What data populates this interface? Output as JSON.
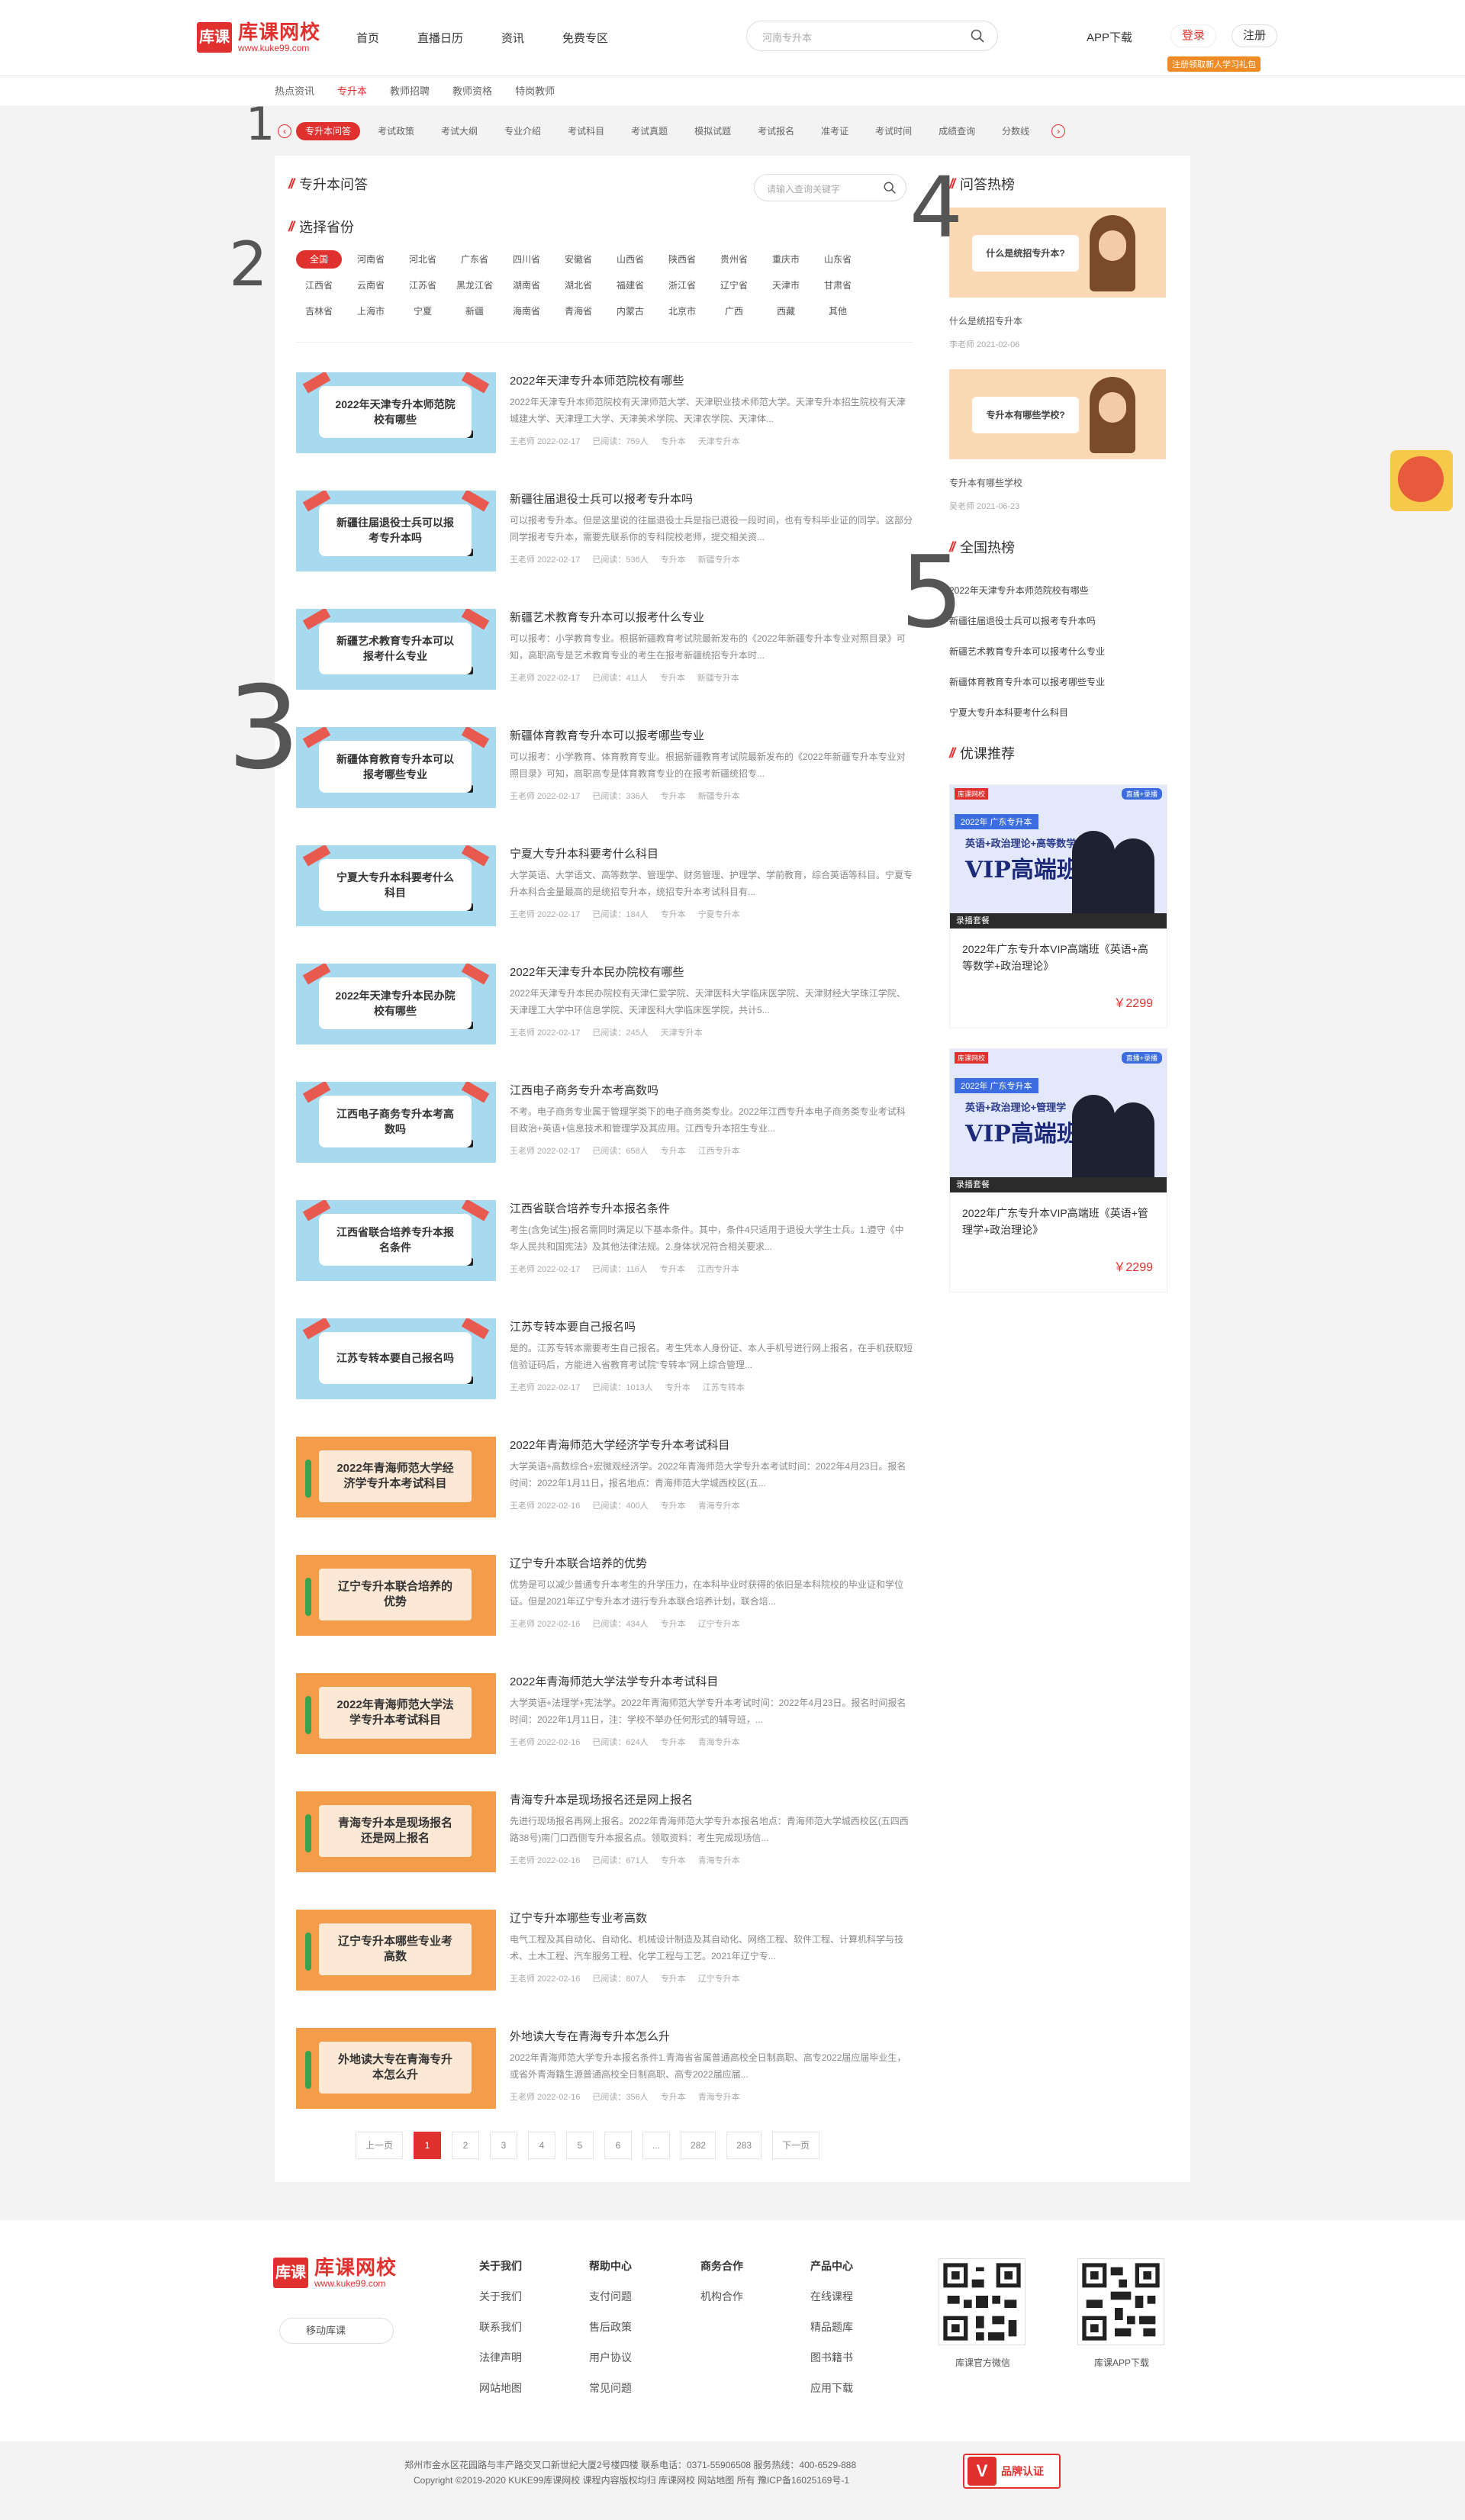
{
  "header": {
    "logo_char": "库课",
    "logo_name": "库课网校",
    "logo_url": "www.kuke99.com",
    "nav": [
      "首页",
      "直播日历",
      "资讯",
      "免费专区"
    ],
    "search_placeholder": "河南专升本",
    "app_download": "APP下载",
    "login": "登录",
    "register": "注册",
    "register_badge": "注册领取新人学习礼包"
  },
  "subnav": {
    "items": [
      "热点资讯",
      "专升本",
      "教师招聘",
      "教师资格",
      "特岗教师"
    ],
    "active": 1
  },
  "tagbar": {
    "tags": [
      "专升本问答",
      "考试政策",
      "考试大纲",
      "专业介绍",
      "考试科目",
      "考试真题",
      "模拟试题",
      "考试报名",
      "准考证",
      "考试时间",
      "成绩查询",
      "分数线"
    ],
    "active": 0,
    "prev_arrow": "‹",
    "next_arrow": "›"
  },
  "qa": {
    "title": "专升本问答",
    "search_placeholder": "请输入查询关键字",
    "province_title": "选择省份",
    "provinces": [
      "全国",
      "河南省",
      "河北省",
      "广东省",
      "四川省",
      "安徽省",
      "山西省",
      "陕西省",
      "贵州省",
      "重庆市",
      "山东省",
      "江西省",
      "云南省",
      "江苏省",
      "黑龙江省",
      "湖南省",
      "湖北省",
      "福建省",
      "浙江省",
      "辽宁省",
      "天津市",
      "甘肃省",
      "吉林省",
      "上海市",
      "宁夏",
      "新疆",
      "海南省",
      "青海省",
      "内蒙古",
      "北京市",
      "广西",
      "西藏",
      "其他"
    ],
    "active_province": 0
  },
  "articles": [
    {
      "thumb": "2022年天津专升本师范院校有哪些",
      "style": "blue",
      "title": "2022年天津专升本师范院校有哪些",
      "desc": "2022年天津专升本师范院校有天津师范大学、天津职业技术师范大学。天津专升本招生院校有天津城建大学、天津理工大学、天津美术学院、天津农学院、天津体...",
      "author": "王老师 2022-02-17",
      "views": "已阅读：759人",
      "tag1": "专升本",
      "tag2": "天津专升本"
    },
    {
      "thumb": "新疆往届退役士兵可以报考专升本吗",
      "style": "blue",
      "title": "新疆往届退役士兵可以报考专升本吗",
      "desc": "可以报考专升本。但是这里说的往届退役士兵是指已退役一段时间，也有专科毕业证的同学。这部分同学报考专升本，需要先联系你的专科院校老师，提交相关资...",
      "author": "王老师 2022-02-17",
      "views": "已阅读：536人",
      "tag1": "专升本",
      "tag2": "新疆专升本"
    },
    {
      "thumb": "新疆艺术教育专升本可以报考什么专业",
      "style": "blue",
      "title": "新疆艺术教育专升本可以报考什么专业",
      "desc": "可以报考：小学教育专业。根据新疆教育考试院最新发布的《2022年新疆专升本专业对照目录》可知，高职高专是艺术教育专业的考生在报考新疆统招专升本时...",
      "author": "王老师 2022-02-17",
      "views": "已阅读：411人",
      "tag1": "专升本",
      "tag2": "新疆专升本"
    },
    {
      "thumb": "新疆体育教育专升本可以报考哪些专业",
      "style": "blue",
      "title": "新疆体育教育专升本可以报考哪些专业",
      "desc": "可以报考：小学教育、体育教育专业。根据新疆教育考试院最新发布的《2022年新疆专升本专业对照目录》可知，高职高专是体育教育专业的在报考新疆统招专...",
      "author": "王老师 2022-02-17",
      "views": "已阅读：336人",
      "tag1": "专升本",
      "tag2": "新疆专升本"
    },
    {
      "thumb": "宁夏大专升本科要考什么科目",
      "style": "blue",
      "title": "宁夏大专升本科要考什么科目",
      "desc": "大学英语、大学语文、高等数学、管理学、财务管理、护理学、学前教育，综合英语等科目。宁夏专升本科合金量最高的是统招专升本，统招专升本考试科目有...",
      "author": "王老师 2022-02-17",
      "views": "已阅读：184人",
      "tag1": "专升本",
      "tag2": "宁夏专升本"
    },
    {
      "thumb": "2022年天津专升本民办院校有哪些",
      "style": "blue",
      "title": "2022年天津专升本民办院校有哪些",
      "desc": "2022年天津专升本民办院校有天津仁爱学院、天津医科大学临床医学院、天津财经大学珠江学院、天津理工大学中环信息学院、天津医科大学临床医学院，共计5...",
      "author": "王老师 2022-02-17",
      "views": "已阅读：245人",
      "tag1": "天津专升本",
      "tag2": ""
    },
    {
      "thumb": "江西电子商务专升本考高数吗",
      "style": "blue",
      "title": "江西电子商务专升本考高数吗",
      "desc": "不考。电子商务专业属于管理学类下的电子商务类专业。2022年江西专升本电子商务类专业考试科目政治+英语+信息技术和管理学及其应用。江西专升本招生专业...",
      "author": "王老师 2022-02-17",
      "views": "已阅读：658人",
      "tag1": "专升本",
      "tag2": "江西专升本"
    },
    {
      "thumb": "江西省联合培养专升本报名条件",
      "style": "blue",
      "title": "江西省联合培养专升本报名条件",
      "desc": "考生(含免试生)报名需同时满足以下基本条件。其中，条件4只适用于退役大学生士兵。1.遵守《中华人民共和国宪法》及其他法律法规。2.身体状况符合相关要求...",
      "author": "王老师 2022-02-17",
      "views": "已阅读：116人",
      "tag1": "专升本",
      "tag2": "江西专升本"
    },
    {
      "thumb": "江苏专转本要自己报名吗",
      "style": "blue",
      "title": "江苏专转本要自己报名吗",
      "desc": "是的。江苏专转本需要考生自己报名。考生凭本人身份证、本人手机号进行网上报名，在手机获取短信验证码后，方能进入省教育考试院“专转本”网上综合管理...",
      "author": "王老师 2022-02-17",
      "views": "已阅读：1013人",
      "tag1": "专升本",
      "tag2": "江苏专转本"
    },
    {
      "thumb": "2022年青海师范大学经济学专升本考试科目",
      "style": "orange",
      "title": "2022年青海师范大学经济学专升本考试科目",
      "desc": "大学英语+高数综合+宏微观经济学。2022年青海师范大学专升本考试时间：2022年4月23日。报名时间：2022年1月11日，报名地点：青海师范大学城西校区(五...",
      "author": "王老师 2022-02-16",
      "views": "已阅读：400人",
      "tag1": "专升本",
      "tag2": "青海专升本"
    },
    {
      "thumb": "辽宁专升本联合培养的优势",
      "style": "orange",
      "title": "辽宁专升本联合培养的优势",
      "desc": "优势是可以减少普通专升本考生的升学压力，在本科毕业时获得的依旧是本科院校的毕业证和学位证。但是2021年辽宁专升本才进行专升本联合培养计划，联合培...",
      "author": "王老师 2022-02-16",
      "views": "已阅读：434人",
      "tag1": "专升本",
      "tag2": "辽宁专升本"
    },
    {
      "thumb": "2022年青海师范大学法学专升本考试科目",
      "style": "orange",
      "title": "2022年青海师范大学法学专升本考试科目",
      "desc": "大学英语+法理学+宪法学。2022年青海师范大学专升本考试时间：2022年4月23日。报名时间报名时间：2022年1月11日，注：学校不举办任何形式的辅导班，...",
      "author": "王老师 2022-02-16",
      "views": "已阅读：624人",
      "tag1": "专升本",
      "tag2": "青海专升本"
    },
    {
      "thumb": "青海专升本是现场报名还是网上报名",
      "style": "orange",
      "title": "青海专升本是现场报名还是网上报名",
      "desc": "先进行现场报名再网上报名。2022年青海师范大学专升本报名地点：青海师范大学城西校区(五四西路38号)南门口西侧专升本报名点。领取资料：考生完成现场信...",
      "author": "王老师 2022-02-16",
      "views": "已阅读：671人",
      "tag1": "专升本",
      "tag2": "青海专升本"
    },
    {
      "thumb": "辽宁专升本哪些专业考高数",
      "style": "orange",
      "title": "辽宁专升本哪些专业考高数",
      "desc": "电气工程及其自动化、自动化、机械设计制造及其自动化、网络工程、软件工程、计算机科学与技术、土木工程、汽车服务工程、化学工程与工艺。2021年辽宁专...",
      "author": "王老师 2022-02-16",
      "views": "已阅读：807人",
      "tag1": "专升本",
      "tag2": "辽宁专升本"
    },
    {
      "thumb": "外地读大专在青海专升本怎么升",
      "style": "orange",
      "title": "外地读大专在青海专升本怎么升",
      "desc": "2022年青海师范大学专升本报名条件1.青海省省属普通高校全日制高职、高专2022届应届毕业生，或省外青海籍生源普通高校全日制高职、高专2022届应届...",
      "author": "王老师 2022-02-16",
      "views": "已阅读：356人",
      "tag1": "专升本",
      "tag2": "青海专升本"
    }
  ],
  "pager": {
    "prev": "上一页",
    "pages": [
      "1",
      "2",
      "3",
      "4",
      "5",
      "6",
      "...",
      "282",
      "283"
    ],
    "active": 0,
    "next": "下一页"
  },
  "hot_qa": {
    "title": "问答热榜",
    "items": [
      {
        "img_text": "什么是统招专升本?",
        "title": "什么是统招专升本",
        "meta": "李老师 2021-02-06"
      },
      {
        "img_text": "专升本有哪些学校?",
        "title": "专升本有哪些学校",
        "meta": "吴老师 2021-06-23"
      }
    ]
  },
  "national_hot": {
    "title": "全国热榜",
    "items": [
      "2022年天津专升本师范院校有哪些",
      "新疆往届退役士兵可以报考专升本吗",
      "新疆艺术教育专升本可以报考什么专业",
      "新疆体育教育专升本可以报考哪些专业",
      "宁夏大专升本科要考什么科目"
    ]
  },
  "courses": {
    "title": "优课推荐",
    "items": [
      {
        "tag1": "库课网校",
        "tag2": "直播+录播",
        "year": "2022年 广东专升本",
        "subjects": "英语+政治理论+高等数学",
        "vip": "VIP高端班",
        "bar": "录播套餐",
        "title": "2022年广东专升本VIP高端班《英语+高等数学+政治理论》",
        "price": "￥2299"
      },
      {
        "tag1": "库课网校",
        "tag2": "直播+录播",
        "year": "2022年 广东专升本",
        "subjects": "英语+政治理论+管理学",
        "vip": "VIP高端班",
        "bar": "录播套餐",
        "title": "2022年广东专升本VIP高端班《英语+管理学+政治理论》",
        "price": "￥2299"
      }
    ]
  },
  "annotations": [
    "1",
    "2",
    "3",
    "4",
    "5"
  ],
  "footer": {
    "logo_char": "库课",
    "logo_name": "库课网校",
    "logo_url": "www.kuke99.com",
    "mobile": "移动库课",
    "cols": [
      {
        "head": "关于我们",
        "items": [
          "关于我们",
          "联系我们",
          "法律声明",
          "网站地图"
        ]
      },
      {
        "head": "帮助中心",
        "items": [
          "支付问题",
          "售后政策",
          "用户协议",
          "常见问题"
        ]
      },
      {
        "head": "商务合作",
        "items": [
          "机构合作"
        ]
      },
      {
        "head": "产品中心",
        "items": [
          "在线课程",
          "精品题库",
          "图书籍书",
          "应用下载"
        ]
      }
    ],
    "qr": [
      "库课官方微信",
      "库课APP下载"
    ],
    "address": "郑州市金水区花园路与丰产路交叉口新世纪大厦2号楼四楼 联系电话：0371-55906508 服务热线：400-6529-888",
    "copyright": "Copyright ©2019-2020 KUKE99库课网校 课程内容版权均归 库课网校 网站地图 所有 豫ICP备16025169号-1",
    "brand": "品牌认证",
    "brand_char": "V"
  }
}
